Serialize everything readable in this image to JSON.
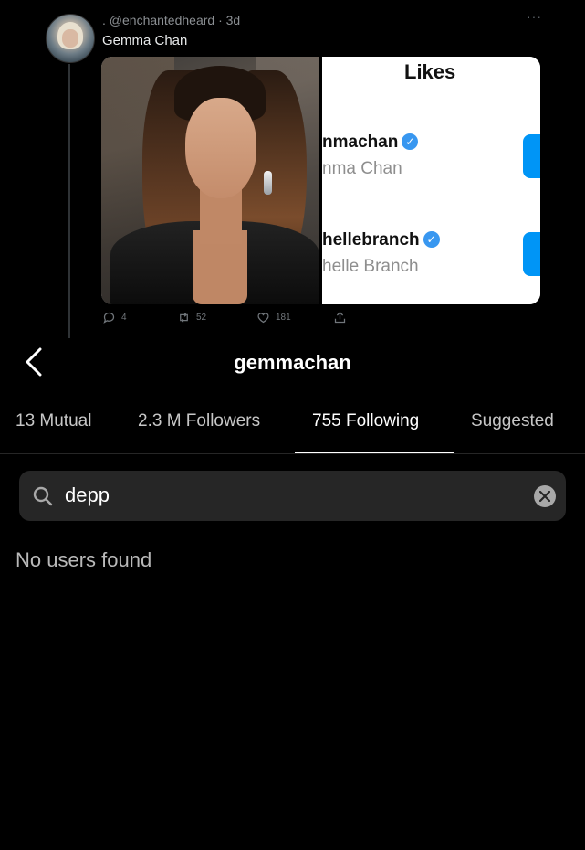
{
  "tweet": {
    "handle": ". @enchantedheard · 3d",
    "text": "Gemma Chan",
    "more": "···",
    "media": {
      "likes_header": "Likes",
      "likes_users": [
        {
          "username": "nmachan",
          "name": "nma Chan",
          "verified": true
        },
        {
          "username": "hellebranch",
          "name": "helle Branch",
          "verified": true
        }
      ]
    },
    "actions": {
      "replies": "4",
      "retweets": "52",
      "likes": "181"
    }
  },
  "instagram": {
    "title": "gemmachan",
    "tabs": [
      {
        "label": "13 Mutual",
        "active": false
      },
      {
        "label": "2.3 M Followers",
        "active": false
      },
      {
        "label": "755 Following",
        "active": true
      },
      {
        "label": "Suggested",
        "active": false
      }
    ],
    "search": {
      "value": "depp"
    },
    "empty_message": "No users found"
  },
  "colors": {
    "background": "#000000",
    "accent_blue": "#0095f6",
    "verified_blue": "#3897f0",
    "search_bg": "#262626"
  }
}
